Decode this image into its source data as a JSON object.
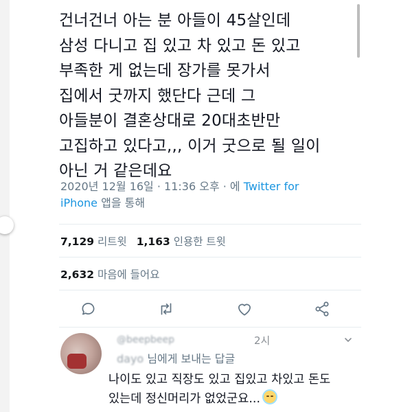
{
  "tweet": {
    "lines": [
      "건너건너 아는 분 아들이 45살인데",
      "삼성 다니고 집 있고 차 있고 돈 있고",
      "부족한 게 없는데 장가를 못가서",
      "집에서 굿까지 했단다 근데 그",
      "아들분이 결혼상대로 20대초반만",
      "고집하고 있다고,,, 이거 굿으로 될 일이",
      "아닌 거 같은데요"
    ],
    "timestamp": "2020년 12월 16일 · 11:36 오후 · 에 ",
    "source_link_1": "Twitter for",
    "source_link_2": "iPhone",
    "source_suffix": " 앱을 통해"
  },
  "stats": {
    "retweets_count": "7,129",
    "retweets_label": "리트윗",
    "quotes_count": "1,163",
    "quotes_label": "인용한 트윗",
    "likes_count": "2,632",
    "likes_label": "마음에 들어요"
  },
  "actions": {
    "reply_icon": "comment-icon",
    "retweet_icon": "retweet-icon",
    "like_icon": "heart-icon",
    "share_icon": "share-icon"
  },
  "reply": {
    "header_blurred": "@beepbeep",
    "time": "2시",
    "to_handle_blurred": "dayo",
    "to_suffix": "님에게 보내는 답글",
    "text_lines": [
      "나이도 있고 직장도 있고 집있고 차있고 돈도",
      "있는데 정신머리가 없었군요..."
    ]
  },
  "colors": {
    "text": "#141823",
    "muted": "#657786",
    "link": "#1b95e0",
    "divider": "#e6ecf0"
  }
}
